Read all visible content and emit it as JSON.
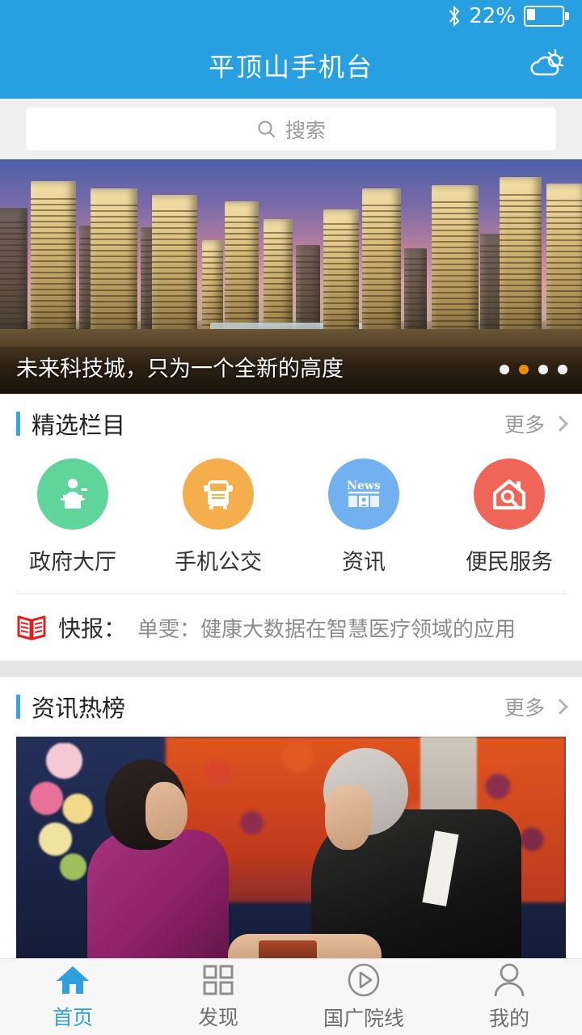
{
  "statusbar": {
    "bluetooth_icon": "bluetooth-icon",
    "battery_percent": "22%",
    "battery_icon": "battery-icon",
    "battery_level": 22
  },
  "header": {
    "title": "平顶山手机台",
    "weather_icon": "partly-cloudy-icon",
    "background_color": "#279fe0"
  },
  "search": {
    "icon": "search-icon",
    "placeholder": "搜索",
    "value": ""
  },
  "banner": {
    "caption": "未来科技城，只为一个全新的高度",
    "image_alt": "city-skyline-towers",
    "dots_total": 4,
    "active_dot": 2,
    "active_dot_color": "#f08a00"
  },
  "featured": {
    "section_title": "精选栏目",
    "more_label": "更多",
    "more_icon": "chevron-right-icon",
    "accent_color": "#3aa3e3",
    "items": [
      {
        "label": "政府大厅",
        "icon": "government-podium-icon",
        "color": "#5fd49b"
      },
      {
        "label": "手机公交",
        "icon": "bus-icon",
        "color": "#f5ae4c"
      },
      {
        "label": "资讯",
        "icon": "news-paper-icon",
        "color": "#72b1ef",
        "badge_text": "News"
      },
      {
        "label": "便民服务",
        "icon": "house-search-icon",
        "color": "#ef6659"
      }
    ]
  },
  "flash": {
    "icon": "open-book-icon",
    "icon_color": "#e01f1f",
    "label": "快报：",
    "text": "单雯：健康大数据在智慧医疗领域的应用"
  },
  "hotnews": {
    "section_title": "资讯热榜",
    "more_label": "更多",
    "more_icon": "chevron-right-icon",
    "image_alt": "nobel-prize-award-ceremony-photo"
  },
  "tabbar": {
    "active_color": "#2f9fe0",
    "inactive_color": "#6e6e6e",
    "items": [
      {
        "label": "首页",
        "icon": "home-icon",
        "active": true
      },
      {
        "label": "发现",
        "icon": "grid-icon",
        "active": false
      },
      {
        "label": "国广院线",
        "icon": "play-circle-icon",
        "active": false
      },
      {
        "label": "我的",
        "icon": "person-icon",
        "active": false
      }
    ]
  }
}
